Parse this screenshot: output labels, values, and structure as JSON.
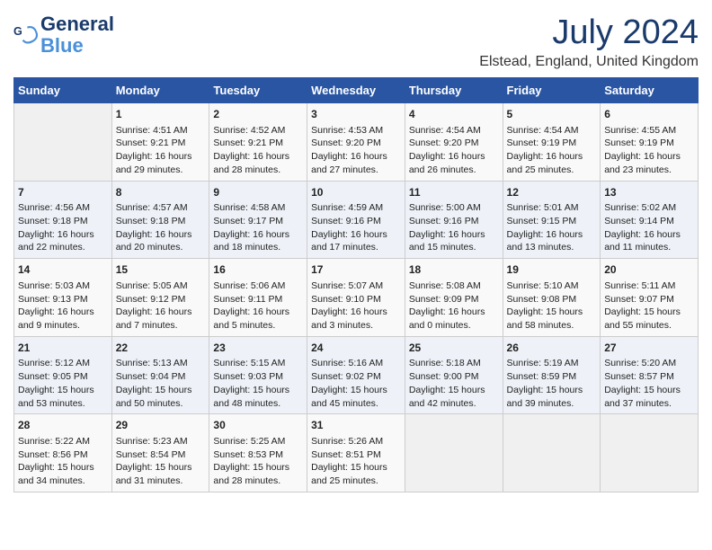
{
  "logo": {
    "line1": "General",
    "line2": "Blue"
  },
  "title": "July 2024",
  "location": "Elstead, England, United Kingdom",
  "days_of_week": [
    "Sunday",
    "Monday",
    "Tuesday",
    "Wednesday",
    "Thursday",
    "Friday",
    "Saturday"
  ],
  "weeks": [
    [
      {
        "day": "",
        "content": ""
      },
      {
        "day": "1",
        "content": "Sunrise: 4:51 AM\nSunset: 9:21 PM\nDaylight: 16 hours\nand 29 minutes."
      },
      {
        "day": "2",
        "content": "Sunrise: 4:52 AM\nSunset: 9:21 PM\nDaylight: 16 hours\nand 28 minutes."
      },
      {
        "day": "3",
        "content": "Sunrise: 4:53 AM\nSunset: 9:20 PM\nDaylight: 16 hours\nand 27 minutes."
      },
      {
        "day": "4",
        "content": "Sunrise: 4:54 AM\nSunset: 9:20 PM\nDaylight: 16 hours\nand 26 minutes."
      },
      {
        "day": "5",
        "content": "Sunrise: 4:54 AM\nSunset: 9:19 PM\nDaylight: 16 hours\nand 25 minutes."
      },
      {
        "day": "6",
        "content": "Sunrise: 4:55 AM\nSunset: 9:19 PM\nDaylight: 16 hours\nand 23 minutes."
      }
    ],
    [
      {
        "day": "7",
        "content": "Sunrise: 4:56 AM\nSunset: 9:18 PM\nDaylight: 16 hours\nand 22 minutes."
      },
      {
        "day": "8",
        "content": "Sunrise: 4:57 AM\nSunset: 9:18 PM\nDaylight: 16 hours\nand 20 minutes."
      },
      {
        "day": "9",
        "content": "Sunrise: 4:58 AM\nSunset: 9:17 PM\nDaylight: 16 hours\nand 18 minutes."
      },
      {
        "day": "10",
        "content": "Sunrise: 4:59 AM\nSunset: 9:16 PM\nDaylight: 16 hours\nand 17 minutes."
      },
      {
        "day": "11",
        "content": "Sunrise: 5:00 AM\nSunset: 9:16 PM\nDaylight: 16 hours\nand 15 minutes."
      },
      {
        "day": "12",
        "content": "Sunrise: 5:01 AM\nSunset: 9:15 PM\nDaylight: 16 hours\nand 13 minutes."
      },
      {
        "day": "13",
        "content": "Sunrise: 5:02 AM\nSunset: 9:14 PM\nDaylight: 16 hours\nand 11 minutes."
      }
    ],
    [
      {
        "day": "14",
        "content": "Sunrise: 5:03 AM\nSunset: 9:13 PM\nDaylight: 16 hours\nand 9 minutes."
      },
      {
        "day": "15",
        "content": "Sunrise: 5:05 AM\nSunset: 9:12 PM\nDaylight: 16 hours\nand 7 minutes."
      },
      {
        "day": "16",
        "content": "Sunrise: 5:06 AM\nSunset: 9:11 PM\nDaylight: 16 hours\nand 5 minutes."
      },
      {
        "day": "17",
        "content": "Sunrise: 5:07 AM\nSunset: 9:10 PM\nDaylight: 16 hours\nand 3 minutes."
      },
      {
        "day": "18",
        "content": "Sunrise: 5:08 AM\nSunset: 9:09 PM\nDaylight: 16 hours\nand 0 minutes."
      },
      {
        "day": "19",
        "content": "Sunrise: 5:10 AM\nSunset: 9:08 PM\nDaylight: 15 hours\nand 58 minutes."
      },
      {
        "day": "20",
        "content": "Sunrise: 5:11 AM\nSunset: 9:07 PM\nDaylight: 15 hours\nand 55 minutes."
      }
    ],
    [
      {
        "day": "21",
        "content": "Sunrise: 5:12 AM\nSunset: 9:05 PM\nDaylight: 15 hours\nand 53 minutes."
      },
      {
        "day": "22",
        "content": "Sunrise: 5:13 AM\nSunset: 9:04 PM\nDaylight: 15 hours\nand 50 minutes."
      },
      {
        "day": "23",
        "content": "Sunrise: 5:15 AM\nSunset: 9:03 PM\nDaylight: 15 hours\nand 48 minutes."
      },
      {
        "day": "24",
        "content": "Sunrise: 5:16 AM\nSunset: 9:02 PM\nDaylight: 15 hours\nand 45 minutes."
      },
      {
        "day": "25",
        "content": "Sunrise: 5:18 AM\nSunset: 9:00 PM\nDaylight: 15 hours\nand 42 minutes."
      },
      {
        "day": "26",
        "content": "Sunrise: 5:19 AM\nSunset: 8:59 PM\nDaylight: 15 hours\nand 39 minutes."
      },
      {
        "day": "27",
        "content": "Sunrise: 5:20 AM\nSunset: 8:57 PM\nDaylight: 15 hours\nand 37 minutes."
      }
    ],
    [
      {
        "day": "28",
        "content": "Sunrise: 5:22 AM\nSunset: 8:56 PM\nDaylight: 15 hours\nand 34 minutes."
      },
      {
        "day": "29",
        "content": "Sunrise: 5:23 AM\nSunset: 8:54 PM\nDaylight: 15 hours\nand 31 minutes."
      },
      {
        "day": "30",
        "content": "Sunrise: 5:25 AM\nSunset: 8:53 PM\nDaylight: 15 hours\nand 28 minutes."
      },
      {
        "day": "31",
        "content": "Sunrise: 5:26 AM\nSunset: 8:51 PM\nDaylight: 15 hours\nand 25 minutes."
      },
      {
        "day": "",
        "content": ""
      },
      {
        "day": "",
        "content": ""
      },
      {
        "day": "",
        "content": ""
      }
    ]
  ]
}
